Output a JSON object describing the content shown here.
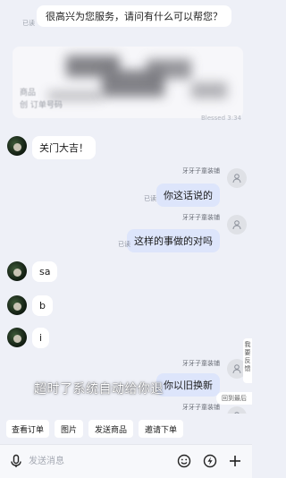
{
  "messages_top": {
    "greeting": "很高兴为您服务，请问有什么可以帮您？",
    "read": "已读"
  },
  "card": {
    "text1": "商品",
    "text2": "创 订单号码",
    "time": "Blessed 3:34"
  },
  "chat": [
    {
      "side": "left",
      "text": "关门大吉！"
    },
    {
      "side": "right",
      "sender": "牙牙子童装铺",
      "text": "你这话说的",
      "read": "已读"
    },
    {
      "side": "right",
      "sender": "牙牙子童装铺",
      "text": "这样的事做的对吗",
      "read": "已读"
    },
    {
      "side": "left",
      "text": "sa"
    },
    {
      "side": "left",
      "text": "b"
    },
    {
      "side": "left",
      "text": "i"
    },
    {
      "side": "right",
      "sender": "牙牙子童装铺",
      "text": "你以旧换新"
    },
    {
      "side": "right",
      "sender": "牙牙子童装铺",
      "text": ""
    }
  ],
  "toast": "超时了系统自动给你退",
  "side": {
    "feedback": "我要反馈",
    "back_bottom": "回到最后"
  },
  "quick_actions": [
    "查看订单",
    "图片",
    "发送商品",
    "邀请下单"
  ],
  "input": {
    "placeholder": "发送消息"
  },
  "icons": {
    "voice": "microphone-icon",
    "emoji": "smile-icon",
    "flash": "lightning-icon",
    "plus": "plus-icon"
  },
  "colors": {
    "background": "#eef0f7",
    "my_bubble": "#dde5fb",
    "their_bubble": "#ffffff"
  }
}
